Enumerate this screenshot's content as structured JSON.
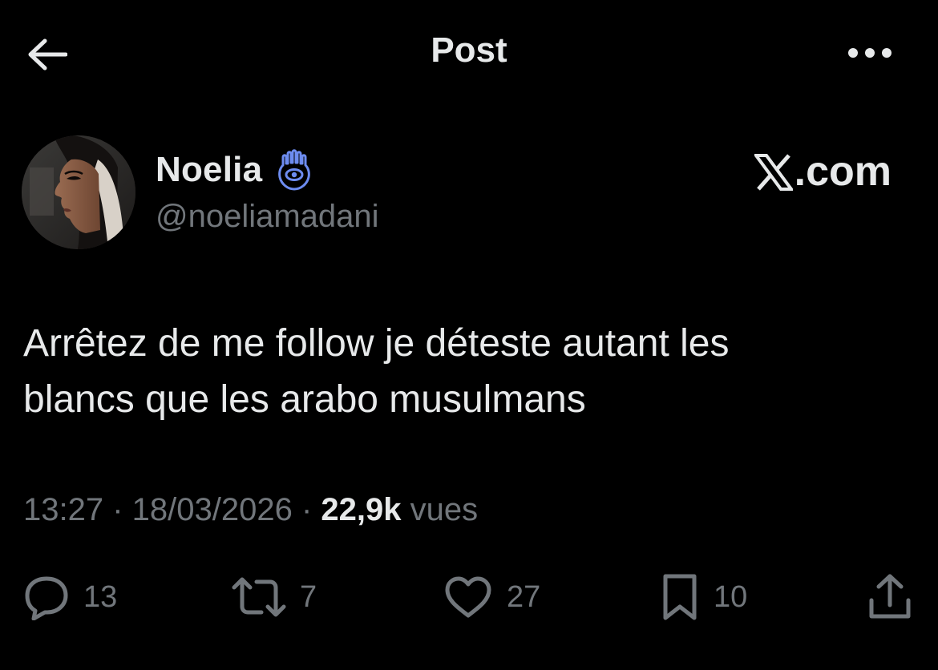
{
  "header": {
    "title": "Post",
    "back_icon": "arrow-left-icon",
    "more_icon": "more-horizontal-icon"
  },
  "author": {
    "name": "Noelia",
    "handle": "@noeliamadani",
    "badge_icon": "hamsa-icon",
    "avatar": "profile-photo"
  },
  "brand": {
    "label": ".com",
    "icon": "x-logo-icon"
  },
  "tweet": {
    "lines": [
      "Arrêtez de me follow je déteste autant les",
      "blancs que les arabo musulmans"
    ]
  },
  "meta": {
    "time": "13:27",
    "sep1": " · ",
    "date": "18/03/2026",
    "sep2": " · ",
    "views_count": "22,9k",
    "views_label": " vues"
  },
  "actions": {
    "reply": {
      "icon": "reply-icon",
      "count": "13"
    },
    "repost": {
      "icon": "repost-icon",
      "count": "7"
    },
    "like": {
      "icon": "heart-icon",
      "count": "27"
    },
    "bookmark": {
      "icon": "bookmark-icon",
      "count": "10"
    },
    "share": {
      "icon": "share-icon"
    }
  },
  "colors": {
    "background": "#000000",
    "primary_text": "#e7e9ea",
    "secondary_text": "#71767b",
    "badge": "#6d8cf0"
  }
}
